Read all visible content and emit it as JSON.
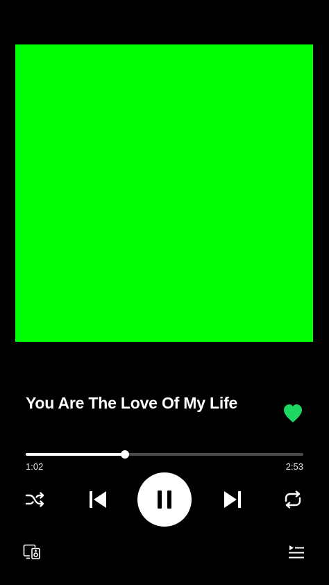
{
  "colors": {
    "background": "#000000",
    "album_art": "#00ff00",
    "like_heart": "#1ed760",
    "progress_fill": "#ffffff",
    "progress_track": "#4a4a4a"
  },
  "track": {
    "title": "You Are The Love Of My Life",
    "liked": true
  },
  "playback": {
    "elapsed": "1:02",
    "duration": "2:53",
    "progress_fraction": 0.358,
    "state": "playing"
  },
  "icons": {
    "like": "heart-icon",
    "shuffle": "shuffle-icon",
    "previous": "skip-previous-icon",
    "play_pause": "pause-icon",
    "next": "skip-next-icon",
    "repeat": "repeat-icon",
    "devices": "connect-device-icon",
    "queue": "queue-icon"
  }
}
